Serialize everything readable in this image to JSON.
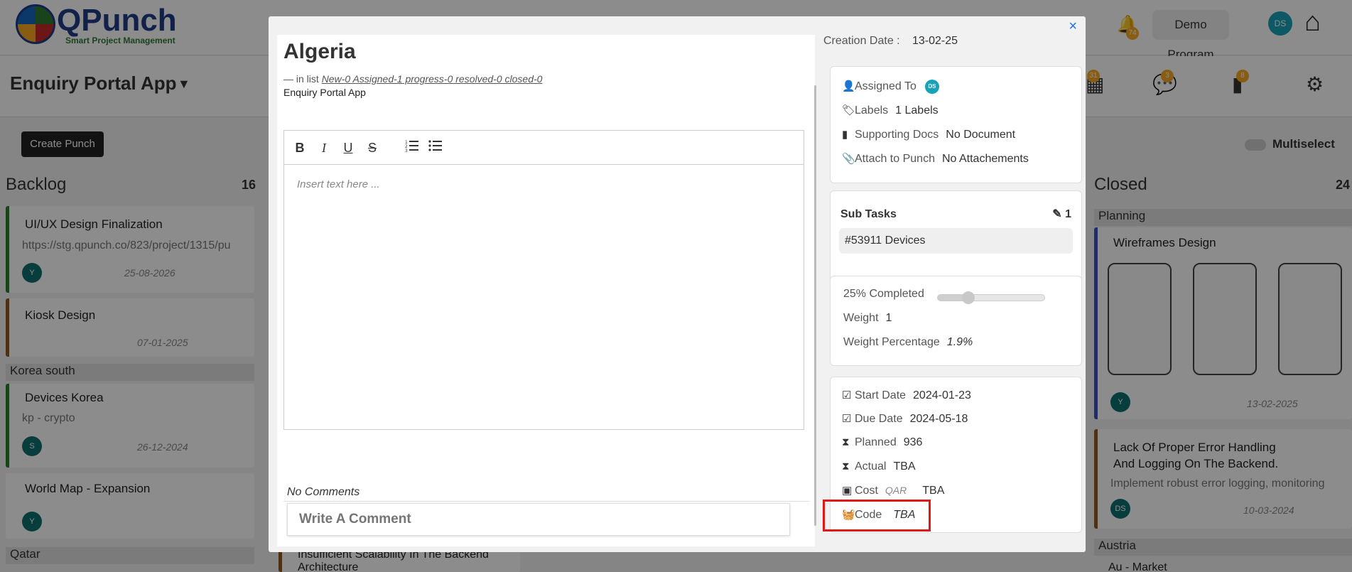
{
  "background": {
    "logo": {
      "text": "QPunch",
      "subtitle": "Smart Project Management"
    },
    "header": {
      "program": "Demo Program",
      "avatar": "DS",
      "notification_count": "74"
    },
    "app_title": "Enquiry Portal App",
    "create_button": "Create Punch",
    "multiselect_label": "Multiselect",
    "badges": [
      "31",
      "3",
      "8"
    ],
    "columns": {
      "backlog": {
        "title": "Backlog",
        "count": "16",
        "cards": [
          {
            "title": "UI/UX Design Finalization",
            "sub": "https://stg.qpunch.co/823/project/1315/pu",
            "date": "25-08-2026",
            "avatar": "Y"
          },
          {
            "title": "Kiosk Design",
            "sub": "",
            "date": "07-01-2025",
            "avatar": ""
          },
          {
            "title": "Devices Korea",
            "sub": "kp - crypto",
            "date": "26-12-2024",
            "avatar": "S"
          },
          {
            "title": "World Map - Expansion",
            "sub": "",
            "date": "",
            "avatar": "Y"
          }
        ],
        "groups": [
          "Korea south",
          "Qatar"
        ],
        "bottom_card": "Insufficient Scalability In The Backend Architecture"
      },
      "closed": {
        "title": "Closed",
        "count": "24",
        "group": "Planning",
        "cards": [
          {
            "title": "Wireframes Design",
            "date": "13-02-2025",
            "avatar": "Y"
          },
          {
            "title": "Lack Of Proper Error Handling And Logging On The Backend.",
            "sub": "Implement robust error logging, monitoring",
            "date": "10-03-2024",
            "avatar": "DS"
          }
        ],
        "group2": "Austria",
        "group2_item": "Au - Market"
      }
    }
  },
  "modal": {
    "close": "×",
    "title": "Algeria",
    "in_list_prefix": "— in list",
    "in_list_link": "New-0 Assigned-1 progress-0 resolved-0 closed-0",
    "app_name": "Enquiry Portal App",
    "editor": {
      "placeholder": "Insert text here ...",
      "tools": [
        "B",
        "I",
        "U",
        "S",
        "ordered-list",
        "bullet-list"
      ]
    },
    "comments": {
      "empty": "No Comments",
      "placeholder": "Write A Comment"
    },
    "creation_label": "Creation Date :",
    "creation_date": "13-02-25",
    "details": {
      "assigned_label": "Assigned To",
      "assigned_avatar": "DS",
      "labels_label": "Labels",
      "labels_value": "1 Labels",
      "docs_label": "Supporting Docs",
      "docs_value": "No Document",
      "attach_label": "Attach to Punch",
      "attach_value": "No Attachements"
    },
    "subtasks": {
      "title": "Sub Tasks",
      "count": "1",
      "items": [
        "#53911 Devices"
      ]
    },
    "progress": {
      "completed_label": "25% Completed",
      "percent": 25,
      "weight_label": "Weight",
      "weight_value": "1",
      "weight_pct_label": "Weight Percentage",
      "weight_pct_value": "1.9%"
    },
    "dates": {
      "start_label": "Start Date",
      "start_value": "2024-01-23",
      "due_label": "Due Date",
      "due_value": "2024-05-18",
      "planned_label": "Planned",
      "planned_value": "936",
      "actual_label": "Actual",
      "actual_value": "TBA",
      "cost_label": "Cost",
      "cost_currency": "QAR",
      "cost_value": "TBA",
      "code_label": "Code",
      "code_value": "TBA"
    }
  },
  "colors": {
    "accent": "#1a73e8",
    "highlight": "#e01818",
    "avatar": "#17a2b8"
  }
}
